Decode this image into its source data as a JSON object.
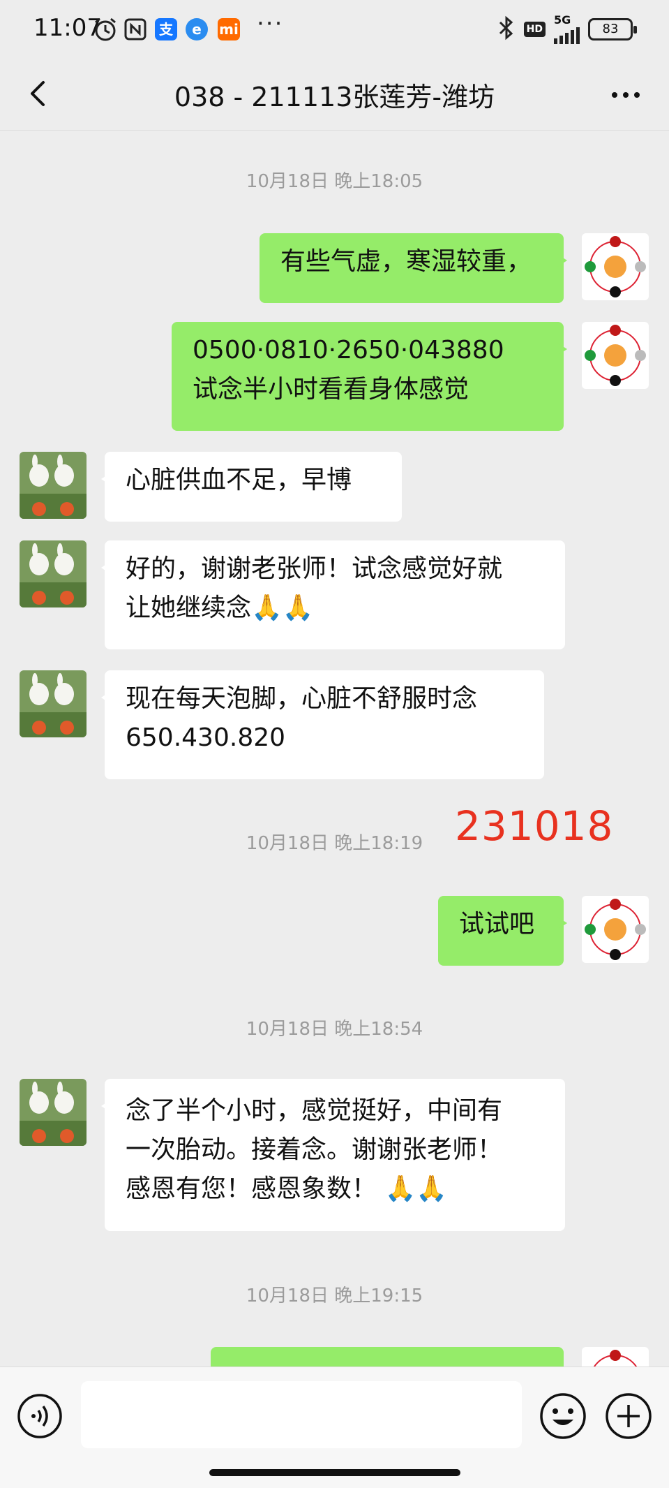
{
  "status_bar": {
    "time": "11:07",
    "network": "5G",
    "hd": "HD",
    "battery": "83",
    "icons": [
      "alarm-icon",
      "nfc-icon",
      "alipay-icon",
      "browser-icon",
      "mi-icon",
      "more-dots-icon",
      "bluetooth-icon",
      "hd-icon",
      "signal-icon",
      "battery-icon"
    ]
  },
  "header": {
    "title": "038 - 211113张莲芳-潍坊",
    "back_icon": "chevron-left-icon",
    "more_icon": "more-horizontal-icon"
  },
  "messages": [
    {
      "type": "time",
      "text": "10月18日 晚上18:05"
    },
    {
      "type": "out",
      "lines": [
        "有些气虚，寒湿较重，"
      ]
    },
    {
      "type": "out",
      "lines": [
        "0500·0810·2650·043880",
        "试念半小时看看身体感觉"
      ]
    },
    {
      "type": "in",
      "lines": [
        "心脏供血不足，早博"
      ]
    },
    {
      "type": "in",
      "lines": [
        "好的，谢谢老张师！试念感觉好就",
        "让她继续念🙏🙏"
      ]
    },
    {
      "type": "in",
      "lines": [
        "现在每天泡脚，心脏不舒服时念",
        "650.430.820"
      ]
    },
    {
      "type": "time",
      "text": "10月18日 晚上18:19"
    },
    {
      "type": "out",
      "lines": [
        "试试吧"
      ]
    },
    {
      "type": "time",
      "text": "10月18日 晚上18:54"
    },
    {
      "type": "in",
      "lines": [
        "念了半个小时，感觉挺好，中间有",
        "一次胎动。接着念。谢谢张老师！",
        "感恩有您！感恩象数！ 🙏🙏"
      ]
    },
    {
      "type": "time",
      "text": "10月18日 晚上19:15"
    }
  ],
  "annotation": "231018",
  "colors": {
    "background": "#ededed",
    "outgoing_bubble": "#95ec69",
    "incoming_bubble": "#ffffff",
    "annotation_red": "#e8311f",
    "time_label": "#9b9b9b"
  },
  "bottom_bar": {
    "voice_icon": "voice-icon",
    "emoji_icon": "emoji-icon",
    "plus_icon": "plus-circle-icon",
    "input_placeholder": ""
  }
}
